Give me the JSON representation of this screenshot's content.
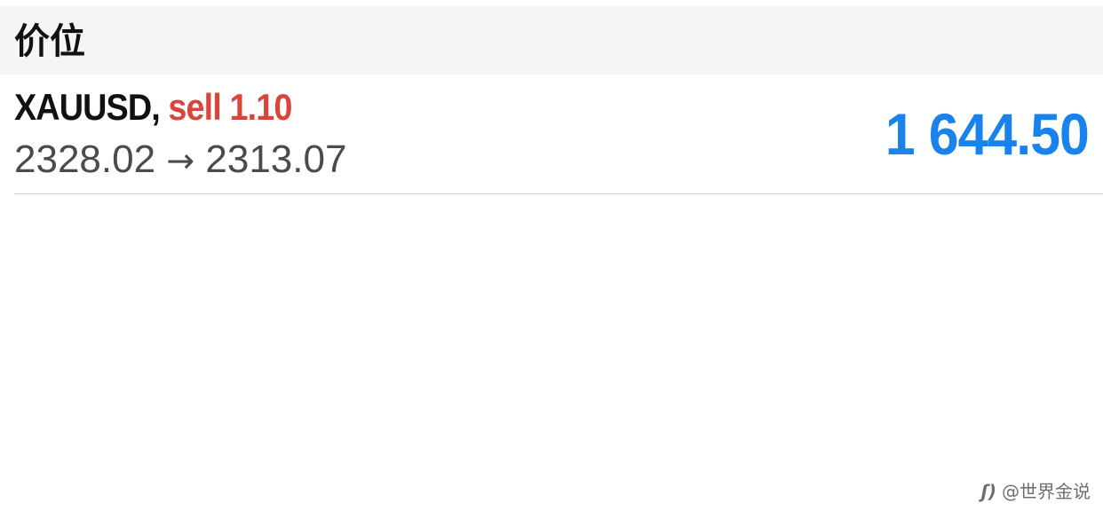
{
  "section": {
    "title": "价位"
  },
  "position": {
    "symbol": "XAUUSD",
    "separator": ",",
    "side": "sell",
    "volume": "1.10",
    "open_price": "2328.02",
    "arrow": "→",
    "current_price": "2313.07",
    "profit": "1 644.50"
  },
  "colors": {
    "sell": "#d9453a",
    "profit_positive": "#1a82ec",
    "header_bg": "#f5f5f5"
  },
  "watermark": {
    "icon": "weibo-icon",
    "text": "@世界金说"
  }
}
